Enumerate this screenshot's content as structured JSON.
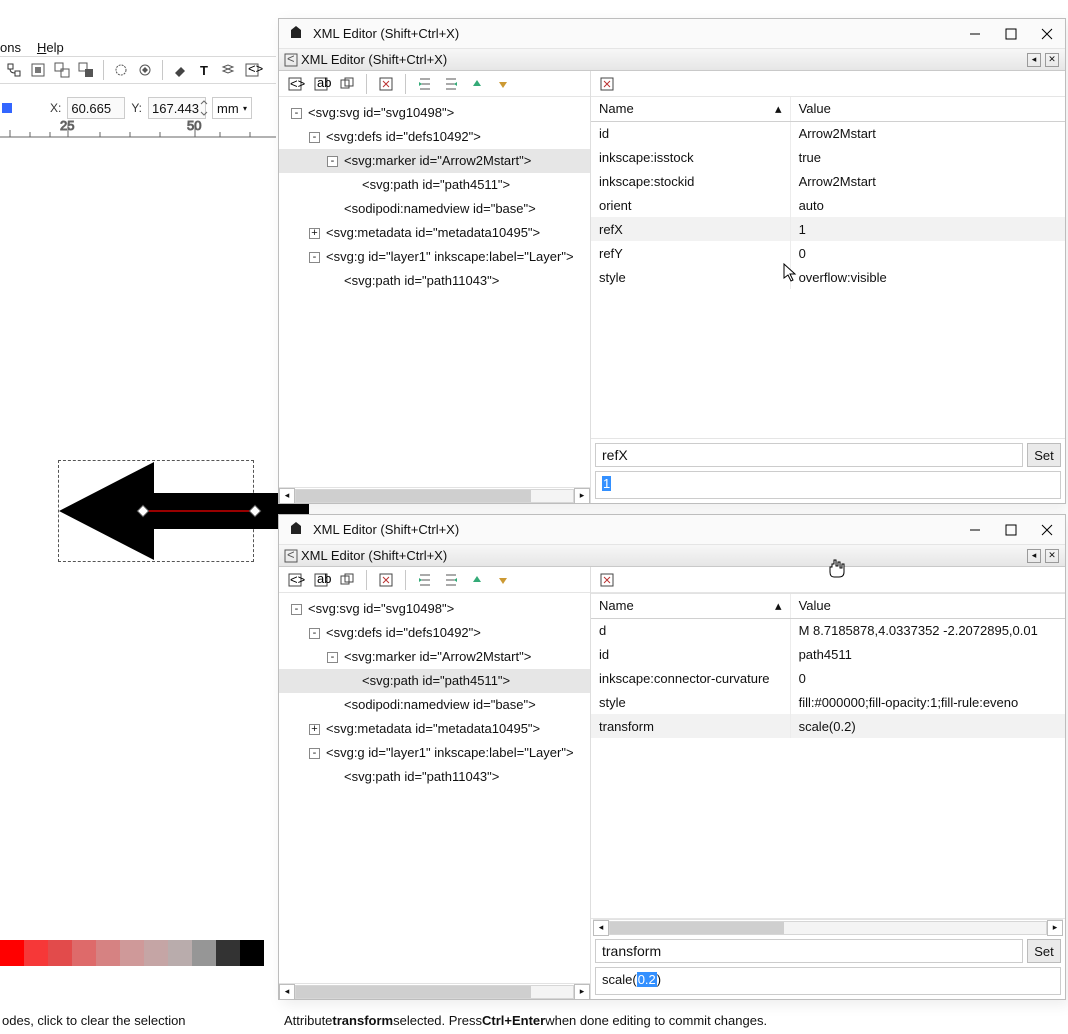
{
  "menu": {
    "items": [
      "ons",
      "Help"
    ],
    "underline_idx": [
      0,
      0
    ]
  },
  "coords": {
    "x_label": "X:",
    "x_value": "60.665",
    "y_label": "Y:",
    "y_value": "167.443",
    "unit": "mm"
  },
  "ruler_marks": [
    "25",
    "50"
  ],
  "palette_colors": [
    "#ff0000",
    "#f63838",
    "#e24b4b",
    "#de6a6a",
    "#d68282",
    "#cf9999",
    "#c5a5a5",
    "#b9acac",
    "#969696",
    "#333333",
    "#000000"
  ],
  "statusbar_left": "odes, click to clear the selection",
  "status_xml_parts": [
    "Attribute ",
    "transform",
    " selected. Press ",
    "Ctrl+Enter",
    " when done editing to commit changes."
  ],
  "tree": {
    "nodes": [
      {
        "depth": 0,
        "toggle": "-",
        "label": "<svg:svg id=\"svg10498\">"
      },
      {
        "depth": 1,
        "toggle": "-",
        "label": "<svg:defs id=\"defs10492\">"
      },
      {
        "depth": 2,
        "toggle": "-",
        "label": "<svg:marker id=\"Arrow2Mstart\">"
      },
      {
        "depth": 3,
        "toggle": "",
        "label": "<svg:path id=\"path4511\">"
      },
      {
        "depth": 2,
        "toggle": "",
        "label": "<sodipodi:namedview id=\"base\">"
      },
      {
        "depth": 1,
        "toggle": "+",
        "label": "<svg:metadata id=\"metadata10495\">"
      },
      {
        "depth": 1,
        "toggle": "-",
        "label": "<svg:g id=\"layer1\" inkscape:label=\"Layer\">"
      },
      {
        "depth": 2,
        "toggle": "",
        "label": "<svg:path id=\"path11043\">"
      }
    ]
  },
  "window1": {
    "chrome_title": "XML Editor (Shift+Ctrl+X)",
    "panel_title": "XML Editor (Shift+Ctrl+X)",
    "attr_headers": {
      "name": "Name",
      "value": "Value"
    },
    "attrs": [
      {
        "name": "id",
        "value": "Arrow2Mstart"
      },
      {
        "name": "inkscape:isstock",
        "value": "true"
      },
      {
        "name": "inkscape:stockid",
        "value": "Arrow2Mstart"
      },
      {
        "name": "orient",
        "value": "auto"
      },
      {
        "name": "refX",
        "value": "1",
        "selected": true
      },
      {
        "name": "refY",
        "value": "0"
      },
      {
        "name": "style",
        "value": "overflow:visible"
      }
    ],
    "selected_tree_index": 2,
    "edit": {
      "name": "refX",
      "value_pre": "",
      "value_sel": "1",
      "value_post": "",
      "set": "Set"
    }
  },
  "window2": {
    "chrome_title": "XML Editor (Shift+Ctrl+X)",
    "panel_title": "XML Editor (Shift+Ctrl+X)",
    "attr_headers": {
      "name": "Name",
      "value": "Value"
    },
    "attrs": [
      {
        "name": "d",
        "value": "M 8.7185878,4.0337352 -2.2072895,0.01"
      },
      {
        "name": "id",
        "value": "path4511"
      },
      {
        "name": "inkscape:connector-curvature",
        "value": "0"
      },
      {
        "name": "style",
        "value": "fill:#000000;fill-opacity:1;fill-rule:eveno"
      },
      {
        "name": "transform",
        "value": "scale(0.2)",
        "selected": true
      }
    ],
    "selected_tree_index": 3,
    "edit": {
      "name": "transform",
      "value_pre": "scale(",
      "value_sel": "0.2",
      "value_post": ")",
      "set": "Set"
    }
  }
}
